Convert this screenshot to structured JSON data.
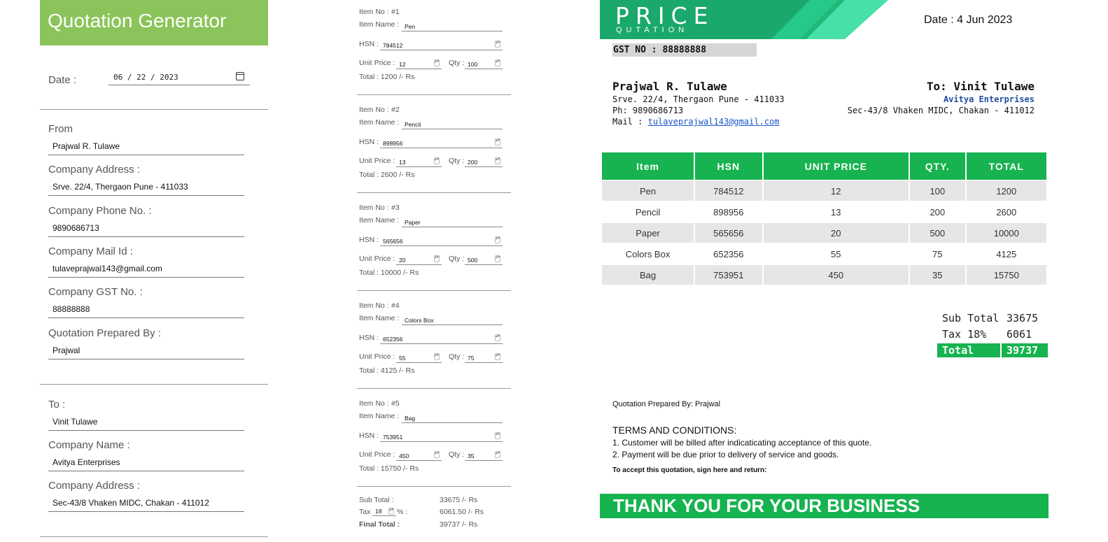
{
  "form": {
    "title": "Quotation Generator",
    "date_label": "Date :",
    "date_value": "06 / 22 / 2023",
    "from_label": "From",
    "from_value": "Prajwal R. Tulawe",
    "company_address_label": "Company Address :",
    "company_address_value": "Srve. 22/4, Thergaon Pune - 411033",
    "company_phone_label": "Company Phone No. :",
    "company_phone_value": "9890686713",
    "company_mail_label": "Company Mail Id :",
    "company_mail_value": "tulaveprajwal143@gmail.com",
    "company_gst_label": "Company GST No. :",
    "company_gst_value": "88888888",
    "prepared_by_label": "Quotation Prepared By :",
    "prepared_by_value": "Prajwal",
    "to_label": "To :",
    "to_value": "Vinit Tulawe",
    "company_name_label": "Company Name :",
    "company_name_value": "Avitya Enterprises",
    "to_address_label": "Company Address :",
    "to_address_value": "Sec-43/8 Vhaken MIDC, Chakan - 411012"
  },
  "items_form": {
    "item_no_label": "Item No :",
    "item_name_label": "Item Name :",
    "hsn_label": "HSN :",
    "unit_price_label": "Unit Price :",
    "qty_label": "Qty :",
    "items": [
      {
        "no": "#1",
        "name": "Pen",
        "hsn": "784512",
        "unit_price": "12",
        "qty": "100",
        "total": "Total : 1200 /- Rs"
      },
      {
        "no": "#2",
        "name": "Pencil",
        "hsn": "898956",
        "unit_price": "13",
        "qty": "200",
        "total": "Total : 2600 /- Rs"
      },
      {
        "no": "#3",
        "name": "Paper",
        "hsn": "565656",
        "unit_price": "20",
        "qty": "500",
        "total": "Total : 10000 /- Rs"
      },
      {
        "no": "#4",
        "name": "Colors Box",
        "hsn": "652356",
        "unit_price": "55",
        "qty": "75",
        "total": "Total : 4125 /- Rs"
      },
      {
        "no": "#5",
        "name": "Bag",
        "hsn": "753951",
        "unit_price": "450",
        "qty": "35",
        "total": "Total : 15750 /- Rs"
      }
    ],
    "sub_total_label": "Sub Total :",
    "sub_total_value": "33675 /- Rs",
    "tax_label": "Tax",
    "tax_percent": "18",
    "tax_suffix": "% :",
    "tax_value": "6061.50 /- Rs",
    "final_total_label": "Final Total :",
    "final_total_value": "39737 /- Rs"
  },
  "quote": {
    "title": "PRICE",
    "subtitle": "QUTATION",
    "date": "Date : 4 Jun 2023",
    "gst": "GST NO : 88888888",
    "from_name": "Prajwal R. Tulawe",
    "from_address": "Srve. 22/4, Thergaon Pune - 411033",
    "from_phone": "Ph: 9890686713",
    "from_mail_label": "Mail :",
    "from_mail": "tulaveprajwal143@gmail.com",
    "to_name": "To: Vinit Tulawe",
    "to_company": "Avitya Enterprises",
    "to_address": "Sec-43/8 Vhaken MIDC, Chakan - 411012",
    "table_headers": [
      "Item",
      "HSN",
      "UNIT PRICE",
      "QTY.",
      "TOTAL"
    ],
    "rows": [
      [
        "Pen",
        "784512",
        "12",
        "100",
        "1200"
      ],
      [
        "Pencil",
        "898956",
        "13",
        "200",
        "2600"
      ],
      [
        "Paper",
        "565656",
        "20",
        "500",
        "10000"
      ],
      [
        "Colors Box",
        "652356",
        "55",
        "75",
        "4125"
      ],
      [
        "Bag",
        "753951",
        "450",
        "35",
        "15750"
      ]
    ],
    "sub_total_label": "Sub Total",
    "sub_total_value": "33675",
    "tax_label": "Tax 18%",
    "tax_value": "6061",
    "total_label": "Total",
    "total_value": "39737",
    "prepared_by": "Quotation Prepared By: Prajwal",
    "terms_title": "TERMS AND CONDITIONS:",
    "terms_1": "1. Customer will be billed after indicaticating acceptance of this quote.",
    "terms_2": "2. Payment will be due prior to delivery of service and goods.",
    "accept_text": "To accept this quotation, sign here and return:",
    "thanks": "THANK YOU FOR YOUR BUSINESS"
  },
  "colors": {
    "form_header": "#8bc45a",
    "accent_green": "#17b350",
    "link_blue": "#1a56c9",
    "company_blue": "#1f4fa0"
  }
}
